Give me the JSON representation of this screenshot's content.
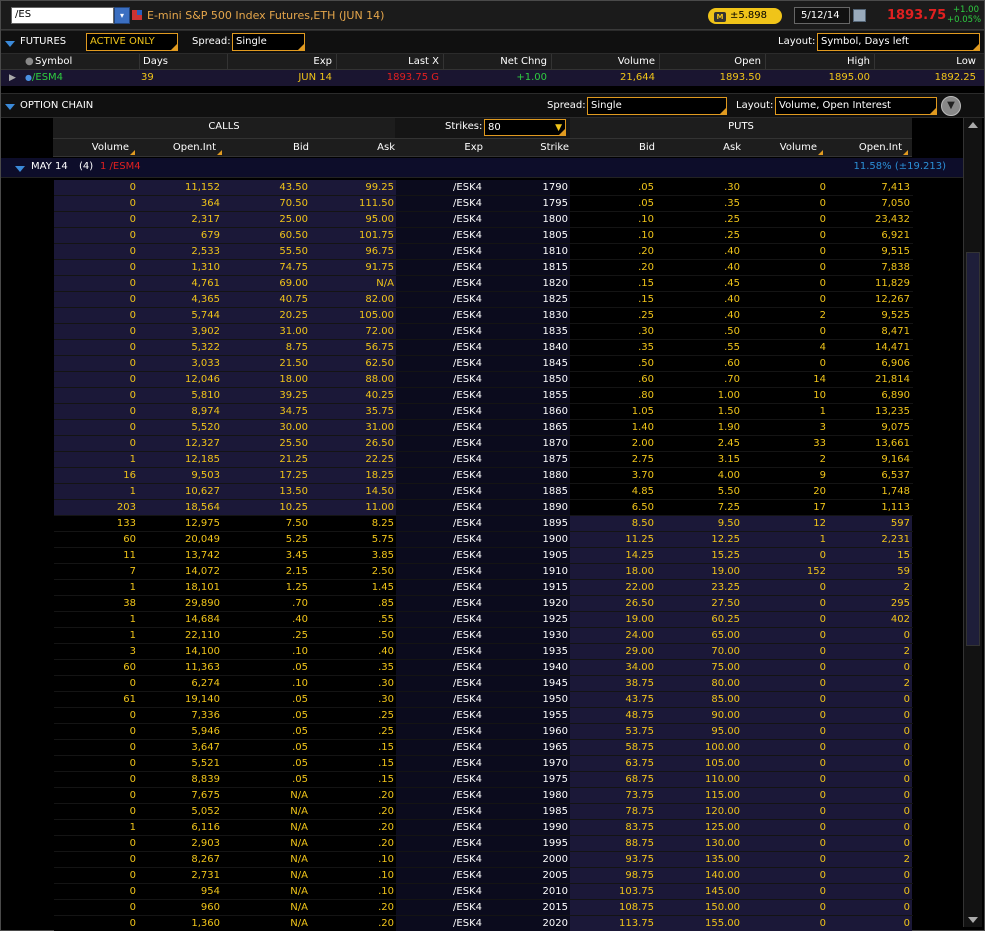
{
  "header": {
    "symbol": "/ES",
    "description": "E-mini S&P 500 Index Futures,ETH (JUN 14)",
    "volatility_badge": "±5.898",
    "date": "5/12/14",
    "last_price": "1893.75",
    "net_change": "+1.00",
    "pct_change": "+0.05%"
  },
  "futures": {
    "title": "FUTURES",
    "filter": "ACTIVE ONLY",
    "spread_label": "Spread:",
    "spread_value": "Single",
    "layout_label": "Layout:",
    "layout_value": "Symbol, Days left",
    "columns": [
      "Symbol",
      "Days",
      "Exp",
      "Last X",
      "Net Chng",
      "Volume",
      "Open",
      "High",
      "Low"
    ],
    "row": {
      "symbol": "/ESM4",
      "days": "39",
      "exp": "JUN 14",
      "last": "1893.75 G",
      "net_chng": "+1.00",
      "volume": "21,644",
      "open": "1893.50",
      "high": "1895.00",
      "low": "1892.25"
    }
  },
  "option_chain": {
    "title": "OPTION CHAIN",
    "spread_label": "Spread:",
    "spread_value": "Single",
    "layout_label": "Layout:",
    "layout_value": "Volume, Open Interest",
    "calls_label": "CALLS",
    "puts_label": "PUTS",
    "strikes_label": "Strikes:",
    "strikes_value": "80",
    "columns": [
      "Volume",
      "Open.Int",
      "Bid",
      "Ask",
      "Exp",
      "Strike",
      "Bid",
      "Ask",
      "Volume",
      "Open.Int"
    ],
    "expiry_label": "MAY 14",
    "expiry_count": "(4)",
    "expiry_underlying": "1 /ESM4",
    "expiry_iv": "11.58% (±19.213)",
    "rows": [
      [
        "0",
        "11,152",
        "43.50",
        "99.25",
        "/ESK4",
        "1790",
        ".05",
        ".30",
        "0",
        "7,413"
      ],
      [
        "0",
        "364",
        "70.50",
        "111.50",
        "/ESK4",
        "1795",
        ".05",
        ".35",
        "0",
        "7,050"
      ],
      [
        "0",
        "2,317",
        "25.00",
        "95.00",
        "/ESK4",
        "1800",
        ".10",
        ".25",
        "0",
        "23,432"
      ],
      [
        "0",
        "679",
        "60.50",
        "101.75",
        "/ESK4",
        "1805",
        ".10",
        ".25",
        "0",
        "6,921"
      ],
      [
        "0",
        "2,533",
        "55.50",
        "96.75",
        "/ESK4",
        "1810",
        ".20",
        ".40",
        "0",
        "9,515"
      ],
      [
        "0",
        "1,310",
        "74.75",
        "91.75",
        "/ESK4",
        "1815",
        ".20",
        ".40",
        "0",
        "7,838"
      ],
      [
        "0",
        "4,761",
        "69.00",
        "N/A",
        "/ESK4",
        "1820",
        ".15",
        ".45",
        "0",
        "11,829"
      ],
      [
        "0",
        "4,365",
        "40.75",
        "82.00",
        "/ESK4",
        "1825",
        ".15",
        ".40",
        "0",
        "12,267"
      ],
      [
        "0",
        "5,744",
        "20.25",
        "105.00",
        "/ESK4",
        "1830",
        ".25",
        ".40",
        "2",
        "9,525"
      ],
      [
        "0",
        "3,902",
        "31.00",
        "72.00",
        "/ESK4",
        "1835",
        ".30",
        ".50",
        "0",
        "8,471"
      ],
      [
        "0",
        "5,322",
        "8.75",
        "56.75",
        "/ESK4",
        "1840",
        ".35",
        ".55",
        "4",
        "14,471"
      ],
      [
        "0",
        "3,033",
        "21.50",
        "62.50",
        "/ESK4",
        "1845",
        ".50",
        ".60",
        "0",
        "6,906"
      ],
      [
        "0",
        "12,046",
        "18.00",
        "88.00",
        "/ESK4",
        "1850",
        ".60",
        ".70",
        "14",
        "21,814"
      ],
      [
        "0",
        "5,810",
        "39.25",
        "40.25",
        "/ESK4",
        "1855",
        ".80",
        "1.00",
        "10",
        "6,890"
      ],
      [
        "0",
        "8,974",
        "34.75",
        "35.75",
        "/ESK4",
        "1860",
        "1.05",
        "1.50",
        "1",
        "13,235"
      ],
      [
        "0",
        "5,520",
        "30.00",
        "31.00",
        "/ESK4",
        "1865",
        "1.40",
        "1.90",
        "3",
        "9,075"
      ],
      [
        "0",
        "12,327",
        "25.50",
        "26.50",
        "/ESK4",
        "1870",
        "2.00",
        "2.45",
        "33",
        "13,661"
      ],
      [
        "1",
        "12,185",
        "21.25",
        "22.25",
        "/ESK4",
        "1875",
        "2.75",
        "3.15",
        "2",
        "9,164"
      ],
      [
        "16",
        "9,503",
        "17.25",
        "18.25",
        "/ESK4",
        "1880",
        "3.70",
        "4.00",
        "9",
        "6,537"
      ],
      [
        "1",
        "10,627",
        "13.50",
        "14.50",
        "/ESK4",
        "1885",
        "4.85",
        "5.50",
        "20",
        "1,748"
      ],
      [
        "203",
        "18,564",
        "10.25",
        "11.00",
        "/ESK4",
        "1890",
        "6.50",
        "7.25",
        "17",
        "1,113"
      ],
      [
        "133",
        "12,975",
        "7.50",
        "8.25",
        "/ESK4",
        "1895",
        "8.50",
        "9.50",
        "12",
        "597"
      ],
      [
        "60",
        "20,049",
        "5.25",
        "5.75",
        "/ESK4",
        "1900",
        "11.25",
        "12.25",
        "1",
        "2,231"
      ],
      [
        "11",
        "13,742",
        "3.45",
        "3.85",
        "/ESK4",
        "1905",
        "14.25",
        "15.25",
        "0",
        "15"
      ],
      [
        "7",
        "14,072",
        "2.15",
        "2.50",
        "/ESK4",
        "1910",
        "18.00",
        "19.00",
        "152",
        "59"
      ],
      [
        "1",
        "18,101",
        "1.25",
        "1.45",
        "/ESK4",
        "1915",
        "22.00",
        "23.25",
        "0",
        "2"
      ],
      [
        "38",
        "29,890",
        ".70",
        ".85",
        "/ESK4",
        "1920",
        "26.50",
        "27.50",
        "0",
        "295"
      ],
      [
        "1",
        "14,684",
        ".40",
        ".55",
        "/ESK4",
        "1925",
        "19.00",
        "60.25",
        "0",
        "402"
      ],
      [
        "1",
        "22,110",
        ".25",
        ".50",
        "/ESK4",
        "1930",
        "24.00",
        "65.00",
        "0",
        "0"
      ],
      [
        "3",
        "14,100",
        ".10",
        ".40",
        "/ESK4",
        "1935",
        "29.00",
        "70.00",
        "0",
        "2"
      ],
      [
        "60",
        "11,363",
        ".05",
        ".35",
        "/ESK4",
        "1940",
        "34.00",
        "75.00",
        "0",
        "0"
      ],
      [
        "0",
        "6,274",
        ".10",
        ".30",
        "/ESK4",
        "1945",
        "38.75",
        "80.00",
        "0",
        "2"
      ],
      [
        "61",
        "19,140",
        ".05",
        ".30",
        "/ESK4",
        "1950",
        "43.75",
        "85.00",
        "0",
        "0"
      ],
      [
        "0",
        "7,336",
        ".05",
        ".25",
        "/ESK4",
        "1955",
        "48.75",
        "90.00",
        "0",
        "0"
      ],
      [
        "0",
        "5,946",
        ".05",
        ".25",
        "/ESK4",
        "1960",
        "53.75",
        "95.00",
        "0",
        "0"
      ],
      [
        "0",
        "3,647",
        ".05",
        ".15",
        "/ESK4",
        "1965",
        "58.75",
        "100.00",
        "0",
        "0"
      ],
      [
        "0",
        "5,521",
        ".05",
        ".15",
        "/ESK4",
        "1970",
        "63.75",
        "105.00",
        "0",
        "0"
      ],
      [
        "0",
        "8,839",
        ".05",
        ".15",
        "/ESK4",
        "1975",
        "68.75",
        "110.00",
        "0",
        "0"
      ],
      [
        "0",
        "7,675",
        "N/A",
        ".20",
        "/ESK4",
        "1980",
        "73.75",
        "115.00",
        "0",
        "0"
      ],
      [
        "0",
        "5,052",
        "N/A",
        ".20",
        "/ESK4",
        "1985",
        "78.75",
        "120.00",
        "0",
        "0"
      ],
      [
        "1",
        "6,116",
        "N/A",
        ".20",
        "/ESK4",
        "1990",
        "83.75",
        "125.00",
        "0",
        "0"
      ],
      [
        "0",
        "2,903",
        "N/A",
        ".20",
        "/ESK4",
        "1995",
        "88.75",
        "130.00",
        "0",
        "0"
      ],
      [
        "0",
        "8,267",
        "N/A",
        ".10",
        "/ESK4",
        "2000",
        "93.75",
        "135.00",
        "0",
        "2"
      ],
      [
        "0",
        "2,731",
        "N/A",
        ".10",
        "/ESK4",
        "2005",
        "98.75",
        "140.00",
        "0",
        "0"
      ],
      [
        "0",
        "954",
        "N/A",
        ".10",
        "/ESK4",
        "2010",
        "103.75",
        "145.00",
        "0",
        "0"
      ],
      [
        "0",
        "960",
        "N/A",
        ".20",
        "/ESK4",
        "2015",
        "108.75",
        "150.00",
        "0",
        "0"
      ],
      [
        "0",
        "1,360",
        "N/A",
        ".20",
        "/ESK4",
        "2020",
        "113.75",
        "155.00",
        "0",
        "0"
      ]
    ]
  },
  "colors": {
    "accent": "#e09a20",
    "itm_bg": "#1b1838",
    "positive": "#2ecc40",
    "negative": "#e02020",
    "badge": "#f0c419"
  }
}
